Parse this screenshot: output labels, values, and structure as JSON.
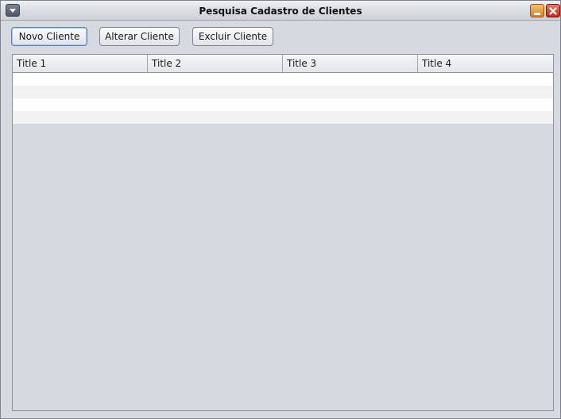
{
  "window": {
    "title": "Pesquisa Cadastro de Clientes",
    "controls": {
      "system_menu_icon": "chevron-down-icon",
      "minimize_icon": "minimize-icon",
      "close_icon": "close-icon"
    }
  },
  "toolbar": {
    "new_label": "Novo Cliente",
    "edit_label": "Alterar Cliente",
    "delete_label": "Excluir Cliente"
  },
  "table": {
    "columns": [
      "Title 1",
      "Title 2",
      "Title 3",
      "Title 4"
    ],
    "rows": [
      [
        "",
        "",
        "",
        ""
      ],
      [
        "",
        "",
        "",
        ""
      ],
      [
        "",
        "",
        "",
        ""
      ],
      [
        "",
        "",
        "",
        ""
      ]
    ]
  },
  "colors": {
    "background": "#d6d9df",
    "row_odd": "#ffffff",
    "row_even": "#f2f2f2",
    "minimize_accent": "#e09a3a",
    "close_accent": "#c8392a"
  }
}
